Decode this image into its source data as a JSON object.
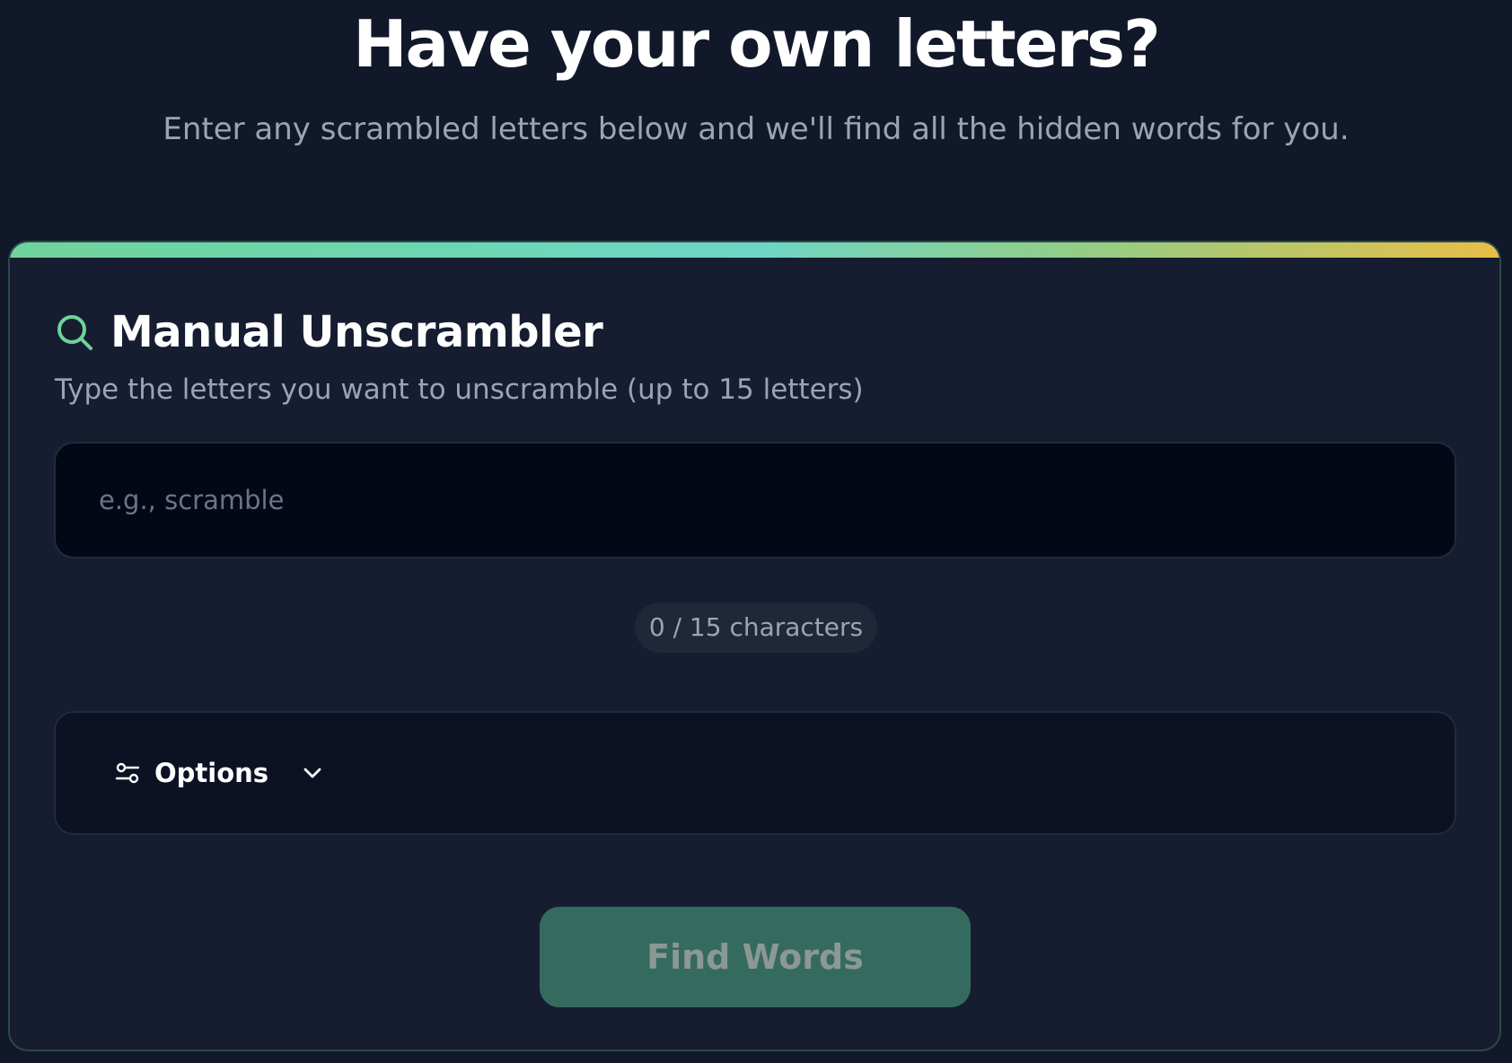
{
  "hero": {
    "title": "Have your own letters?",
    "subtitle": "Enter any scrambled letters below and we'll find all the hidden words for you."
  },
  "card": {
    "title": "Manual Unscrambler",
    "title_icon": "search-icon",
    "description": "Type the letters you want to unscramble (up to 15 letters)",
    "input": {
      "value": "",
      "placeholder": "e.g., scramble"
    },
    "char_count": "0 / 15 characters",
    "options": {
      "label": "Options",
      "icon": "sliders-icon",
      "expand_icon": "chevron-down-icon"
    },
    "submit_label": "Find Words"
  },
  "colors": {
    "background": "#111829",
    "card": "#161d31",
    "accent_green": "#6fd49a",
    "accent_teal": "#6dd6c5",
    "accent_gold": "#e8be48",
    "button": "#356b5f"
  }
}
